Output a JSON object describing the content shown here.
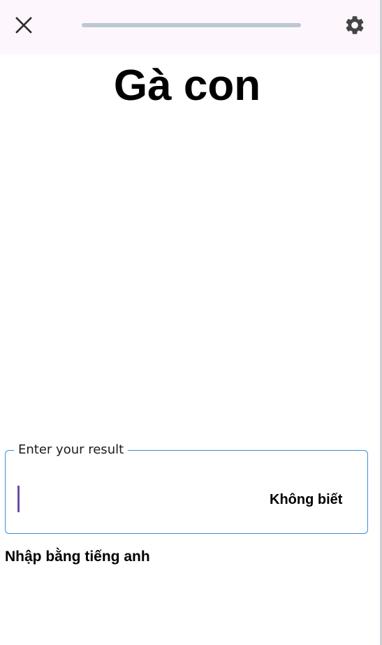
{
  "header": {
    "close_icon": "close-icon",
    "settings_icon": "gear-icon",
    "progress": 0.0
  },
  "word": {
    "text": "Gà con"
  },
  "answer": {
    "label": "Enter your result",
    "value": "",
    "dont_know_label": "Không biết"
  },
  "hint": {
    "text": "Nhập bằng tiếng anh"
  },
  "colors": {
    "topbar_bg": "#fdf6fd",
    "progress_track": "#bdc8d0",
    "field_border": "#3c8fd9",
    "caret": "#6b4fa3",
    "icon": "#444444"
  }
}
